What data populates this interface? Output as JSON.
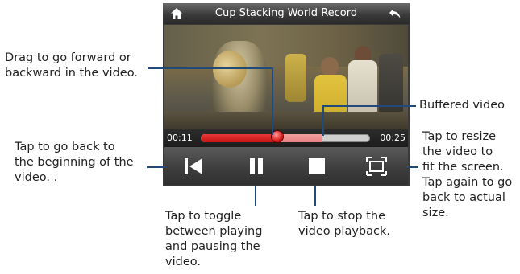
{
  "player": {
    "title": "Cup Stacking World Record",
    "current_time": "00:11",
    "duration": "00:25",
    "played_fraction": 0.45,
    "buffered_fraction": 0.72
  },
  "annotations": {
    "drag": [
      "Drag to go forward or",
      "backward in the video."
    ],
    "buffered": [
      "Buffered video"
    ],
    "back_to_start": [
      "Tap to go back to",
      "the beginning of the",
      "video. ."
    ],
    "resize": [
      "Tap to resize",
      "the video to",
      "fit the screen.",
      "Tap again to go",
      "back to actual",
      "size."
    ],
    "toggle": [
      "Tap to toggle",
      "between playing",
      "and pausing the",
      "video."
    ],
    "stop": [
      "Tap to stop the",
      "video playback."
    ]
  },
  "icons": {
    "home": "home-icon",
    "back": "back-arrow-icon",
    "previous": "skip-to-start-icon",
    "pause": "pause-icon",
    "stop": "stop-icon",
    "resize": "fullscreen-icon"
  },
  "colors": {
    "played": "#c61414",
    "buffered": "#e98080",
    "callout_line": "#1f4a7a"
  }
}
